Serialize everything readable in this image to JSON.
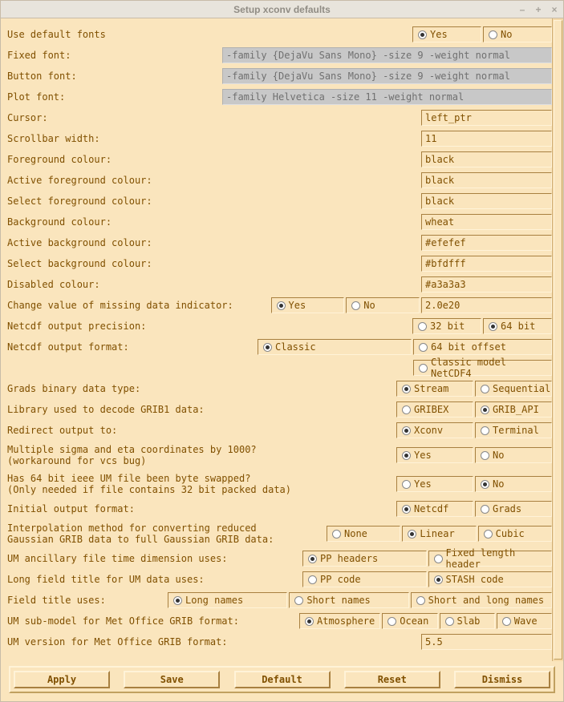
{
  "window": {
    "title": "Setup xconv defaults"
  },
  "rows": {
    "use_default_fonts": {
      "label": "Use default fonts",
      "yes": "Yes",
      "no": "No"
    },
    "fixed_font": {
      "label": "Fixed font:",
      "value": "-family {DejaVu Sans Mono} -size 9 -weight normal"
    },
    "button_font": {
      "label": "Button font:",
      "value": "-family {DejaVu Sans Mono} -size 9 -weight normal"
    },
    "plot_font": {
      "label": "Plot font:",
      "value": "-family Helvetica -size 11 -weight normal"
    },
    "cursor": {
      "label": "Cursor:",
      "value": "left_ptr"
    },
    "scrollbar_width": {
      "label": "Scrollbar width:",
      "value": "11"
    },
    "fg": {
      "label": "Foreground colour:",
      "value": "black"
    },
    "afg": {
      "label": "Active foreground colour:",
      "value": "black"
    },
    "sfg": {
      "label": "Select foreground colour:",
      "value": "black"
    },
    "bg": {
      "label": "Background colour:",
      "value": "wheat"
    },
    "abg": {
      "label": "Active background colour:",
      "value": "#efefef"
    },
    "sbg": {
      "label": "Select background colour:",
      "value": "#bfdfff"
    },
    "dc": {
      "label": "Disabled colour:",
      "value": "#a3a3a3"
    },
    "missing": {
      "label": "Change value of missing data indicator:",
      "yes": "Yes",
      "no": "No",
      "value": "2.0e20"
    },
    "precision": {
      "label": "Netcdf output precision:",
      "b32": "32 bit",
      "b64": "64 bit"
    },
    "ncformat": {
      "label": "Netcdf output format:",
      "classic": "Classic",
      "offset": "64 bit offset",
      "nc4": "Classic model NetCDF4"
    },
    "grads": {
      "label": "Grads binary data type:",
      "stream": "Stream",
      "seq": "Sequential"
    },
    "grib1": {
      "label": "Library used to decode GRIB1 data:",
      "gribex": "GRIBEX",
      "gribapi": "GRIB_API"
    },
    "redirect": {
      "label": "Redirect output to:",
      "xconv": "Xconv",
      "term": "Terminal"
    },
    "mult1000": {
      "label1": "Multiple sigma and eta coordinates by 1000?",
      "label2": "(workaround for vcs bug)",
      "yes": "Yes",
      "no": "No"
    },
    "byteswap": {
      "label1": "Has 64 bit ieee UM file been byte swapped?",
      "label2": "(Only needed if file contains 32 bit packed data)",
      "yes": "Yes",
      "no": "No"
    },
    "initfmt": {
      "label": "Initial output format:",
      "netcdf": "Netcdf",
      "grads": "Grads"
    },
    "interp": {
      "label1": "Interpolation method for converting reduced",
      "label2": "Gaussian GRIB data to full Gaussian GRIB data:",
      "none": "None",
      "linear": "Linear",
      "cubic": "Cubic"
    },
    "anctime": {
      "label": "UM ancillary file time dimension uses:",
      "pp": "PP headers",
      "flh": "Fixed length header"
    },
    "longtitle": {
      "label": "Long field title for UM data uses:",
      "pp": "PP code",
      "stash": "STASH code"
    },
    "fieldtitle": {
      "label": "Field title uses:",
      "long": "Long names",
      "short": "Short names",
      "both": "Short and long names"
    },
    "submodel": {
      "label": "UM sub-model for Met Office GRIB format:",
      "atmo": "Atmosphere",
      "ocean": "Ocean",
      "slab": "Slab",
      "wave": "Wave"
    },
    "umver": {
      "label": "UM version for Met Office GRIB format:",
      "value": "5.5"
    }
  },
  "buttons": {
    "apply": "Apply",
    "save": "Save",
    "default": "Default",
    "reset": "Reset",
    "dismiss": "Dismiss"
  }
}
